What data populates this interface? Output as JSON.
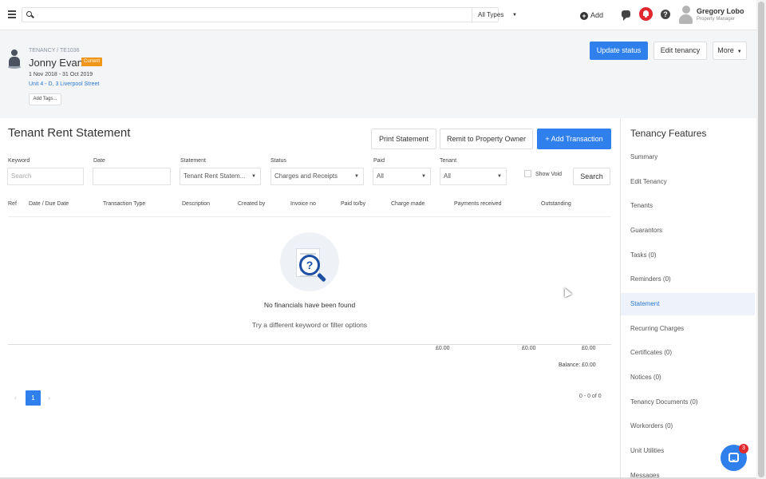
{
  "topbar": {
    "search_placeholder": "",
    "type_select": "All Types",
    "add_label": "Add",
    "user": {
      "name": "Gregory Lobo",
      "role": "Property Manager"
    }
  },
  "header": {
    "breadcrumb": "TENANCY / TE1036",
    "tenant_name": "Jonny Evans",
    "status": "Current",
    "date_range": "1 Nov 2018 - 31 Oct 2019",
    "address": "Unit 4 - D, 3 Liverpool Street",
    "add_tags": "Add Tags...",
    "update_status": "Update status",
    "edit_tenancy": "Edit tenancy",
    "more": "More"
  },
  "main": {
    "title": "Tenant Rent Statement",
    "print_statement": "Print Statement",
    "remit": "Remit to Property Owner",
    "add_transaction": "+ Add Transaction",
    "filters": {
      "keyword_label": "Keyword",
      "keyword_placeholder": "Search",
      "date_label": "Date",
      "statement_label": "Statement",
      "statement_value": "Tenant Rent Statem...",
      "status_label": "Status",
      "status_value": "Charges and Receipts",
      "paid_label": "Paid",
      "paid_value": "All",
      "tenant_label": "Tenant",
      "tenant_value": "All",
      "show_void": "Show Void",
      "search": "Search"
    },
    "columns": [
      "Ref",
      "Date / Due Date",
      "Transaction Type",
      "Description",
      "Created by",
      "Invoice no",
      "Paid to/by",
      "Charge made",
      "Payments received",
      "Outstanding"
    ],
    "empty_title": "No financials have been found",
    "empty_sub": "Try a different keyword or filter options",
    "totals": [
      "£0.00",
      "£0.00",
      "£0.00"
    ],
    "balance": "Balance: £0.00",
    "pager": {
      "prev": "‹",
      "page": "1",
      "next": "›",
      "count": "0 - 0 of 0"
    }
  },
  "sidebar": {
    "title": "Tenancy Features",
    "items": [
      {
        "label": "Summary"
      },
      {
        "label": "Edit Tenancy"
      },
      {
        "label": "Tenants"
      },
      {
        "label": "Guarantors"
      },
      {
        "label": "Tasks (0)"
      },
      {
        "label": "Reminders (0)"
      },
      {
        "label": "Statement"
      },
      {
        "label": "Recurring Charges"
      },
      {
        "label": "Certificates (0)"
      },
      {
        "label": "Notices (0)"
      },
      {
        "label": "Tenancy Documents (0)"
      },
      {
        "label": "Workorders (0)"
      },
      {
        "label": "Unit Utilities"
      },
      {
        "label": "Messages"
      }
    ]
  },
  "chat": {
    "badge": "3"
  },
  "colors": {
    "primary": "#2f80ed",
    "status_badge": "#f0961a",
    "alert": "#e0292f",
    "link": "#2b79d4"
  },
  "icons": [
    "menu-icon",
    "search-icon",
    "plus-icon",
    "chat-icon",
    "bell-icon",
    "help-icon",
    "avatar",
    "tenant-icon",
    "document-search-icon",
    "chat-launcher-icon"
  ]
}
